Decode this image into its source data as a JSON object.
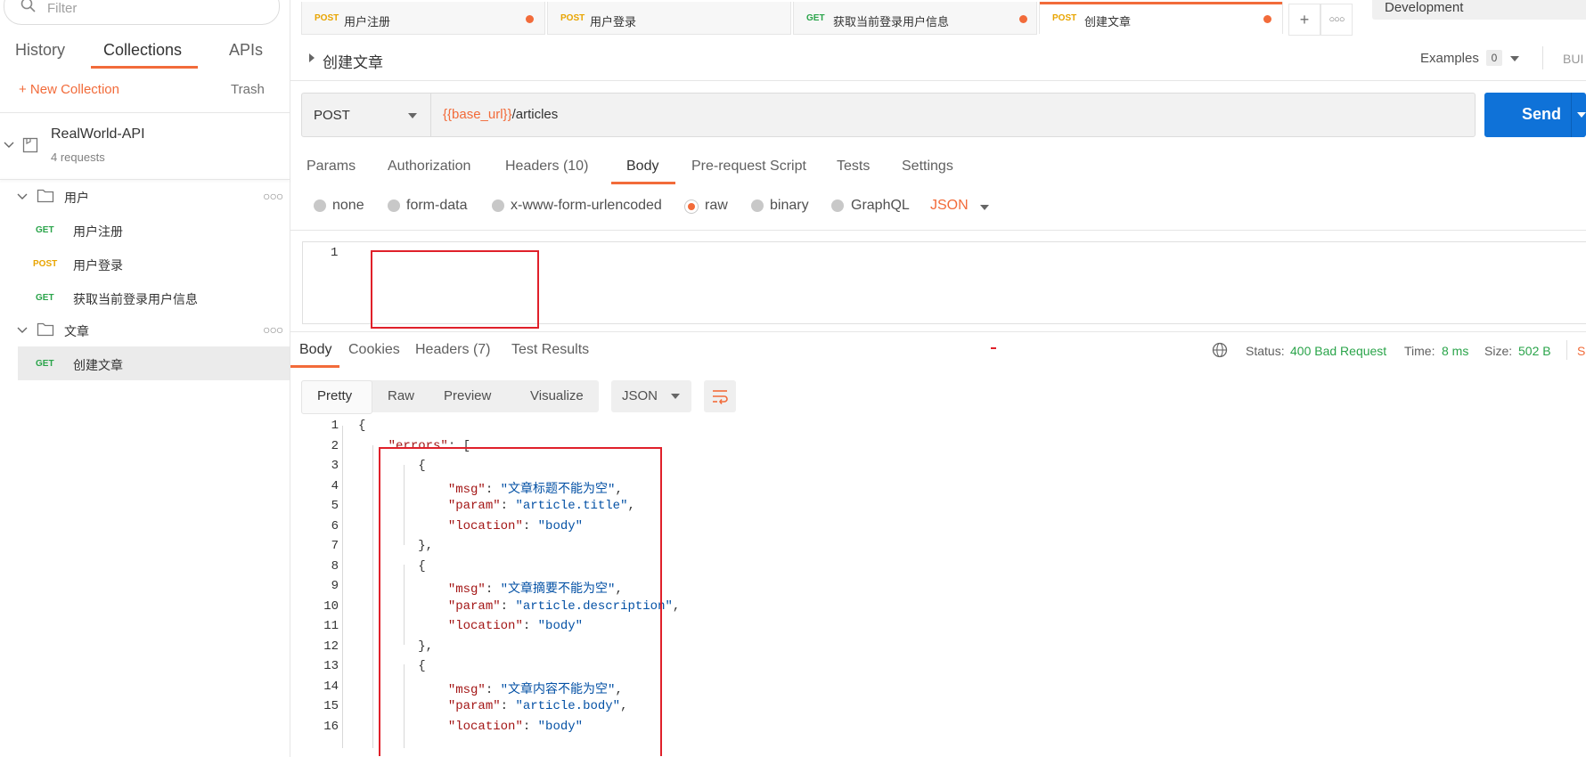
{
  "sidebar": {
    "filter_placeholder": "Filter",
    "tabs": [
      "History",
      "Collections",
      "APIs"
    ],
    "new_collection": "+ New Collection",
    "trash": "Trash",
    "collection": {
      "name": "RealWorld-API",
      "count": "4 requests"
    },
    "folders": [
      {
        "name": "用户",
        "requests": [
          {
            "method": "GET",
            "name": "用户注册"
          },
          {
            "method": "POST",
            "name": "用户登录"
          },
          {
            "method": "GET",
            "name": "获取当前登录用户信息"
          }
        ]
      },
      {
        "name": "文章",
        "requests": [
          {
            "method": "GET",
            "name": "创建文章"
          }
        ]
      }
    ]
  },
  "tabs": [
    {
      "method": "POST",
      "name": "用户注册"
    },
    {
      "method": "POST",
      "name": "用户登录"
    },
    {
      "method": "GET",
      "name": "获取当前登录用户信息"
    },
    {
      "method": "POST",
      "name": "创建文章"
    }
  ],
  "environment": "Development",
  "request": {
    "title": "创建文章",
    "examples_label": "Examples",
    "examples_count": "0",
    "build_label": "BUI",
    "method": "POST",
    "url_var": "{{base_url}}",
    "url_path": "/articles",
    "send": "Send",
    "tabs": {
      "params": "Params",
      "auth": "Authorization",
      "headers": "Headers",
      "headers_count": "(10)",
      "body": "Body",
      "prereq": "Pre-request Script",
      "tests": "Tests",
      "settings": "Settings"
    },
    "body_types": [
      "none",
      "form-data",
      "x-www-form-urlencoded",
      "raw",
      "binary",
      "GraphQL"
    ],
    "body_format": "JSON",
    "editor_line": "1"
  },
  "response": {
    "tabs": {
      "body": "Body",
      "cookies": "Cookies",
      "headers": "Headers",
      "headers_count": "(7)",
      "tests": "Test Results"
    },
    "status_label": "Status:",
    "status_value": "400 Bad Request",
    "time_label": "Time:",
    "time_value": "8 ms",
    "size_label": "Size:",
    "size_value": "502 B",
    "save_fragment": "S",
    "views": [
      "Pretty",
      "Raw",
      "Preview",
      "Visualize"
    ],
    "format": "JSON",
    "lines": [
      "{",
      "    \"errors\": [",
      "        {",
      "            \"msg\": \"文章标题不能为空\",",
      "            \"param\": \"article.title\",",
      "            \"location\": \"body\"",
      "        },",
      "        {",
      "            \"msg\": \"文章摘要不能为空\",",
      "            \"param\": \"article.description\",",
      "            \"location\": \"body\"",
      "        },",
      "        {",
      "            \"msg\": \"文章内容不能为空\",",
      "            \"param\": \"article.body\",",
      "            \"location\": \"body\""
    ]
  }
}
